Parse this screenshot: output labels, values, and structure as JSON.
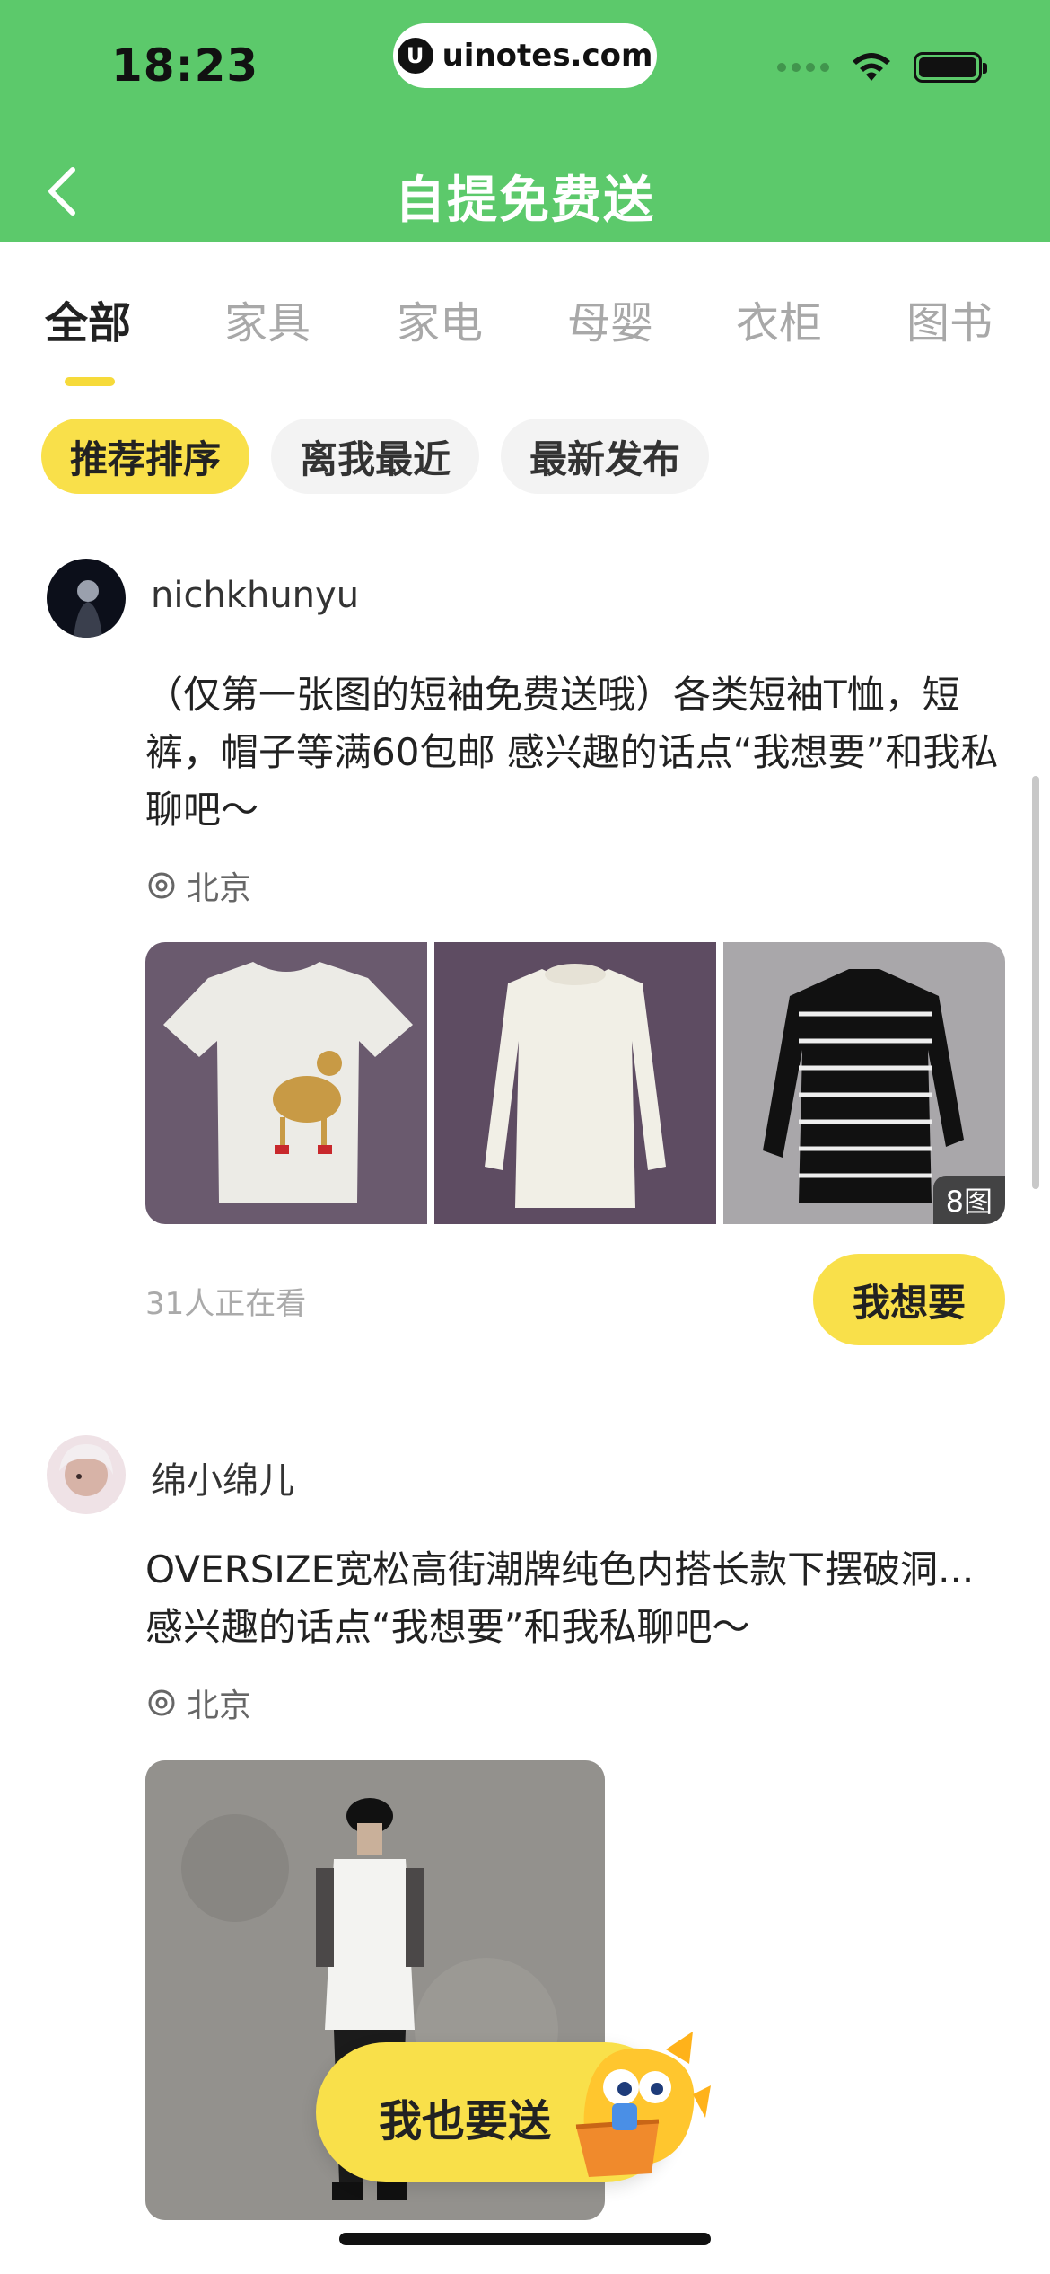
{
  "status_bar": {
    "time": "18:23",
    "url": "uinotes.com"
  },
  "header": {
    "title": "自提免费送"
  },
  "tabs": [
    "全部",
    "家具",
    "家电",
    "母婴",
    "衣柜",
    "图书"
  ],
  "sort_chips": [
    "推荐排序",
    "离我最近",
    "最新发布"
  ],
  "posts": [
    {
      "username": "nichkhunyu",
      "text": "（仅第一张图的短袖免费送哦）各类短袖T恤，短裤，帽子等满60包邮 感兴趣的话点“我想要”和我私聊吧～",
      "location": "北京",
      "image_count": "8图",
      "viewers": "31人正在看",
      "want_label": "我想要"
    },
    {
      "username": "绵小绵儿",
      "text": "OVERSIZE宽松高街潮牌纯色内搭长款下摆破洞... 感兴趣的话点“我想要”和我私聊吧～",
      "location": "北京"
    }
  ],
  "fab": {
    "label": "我也要送"
  },
  "colors": {
    "header_green": "#5cc96b",
    "accent_yellow": "#f9e04a"
  }
}
